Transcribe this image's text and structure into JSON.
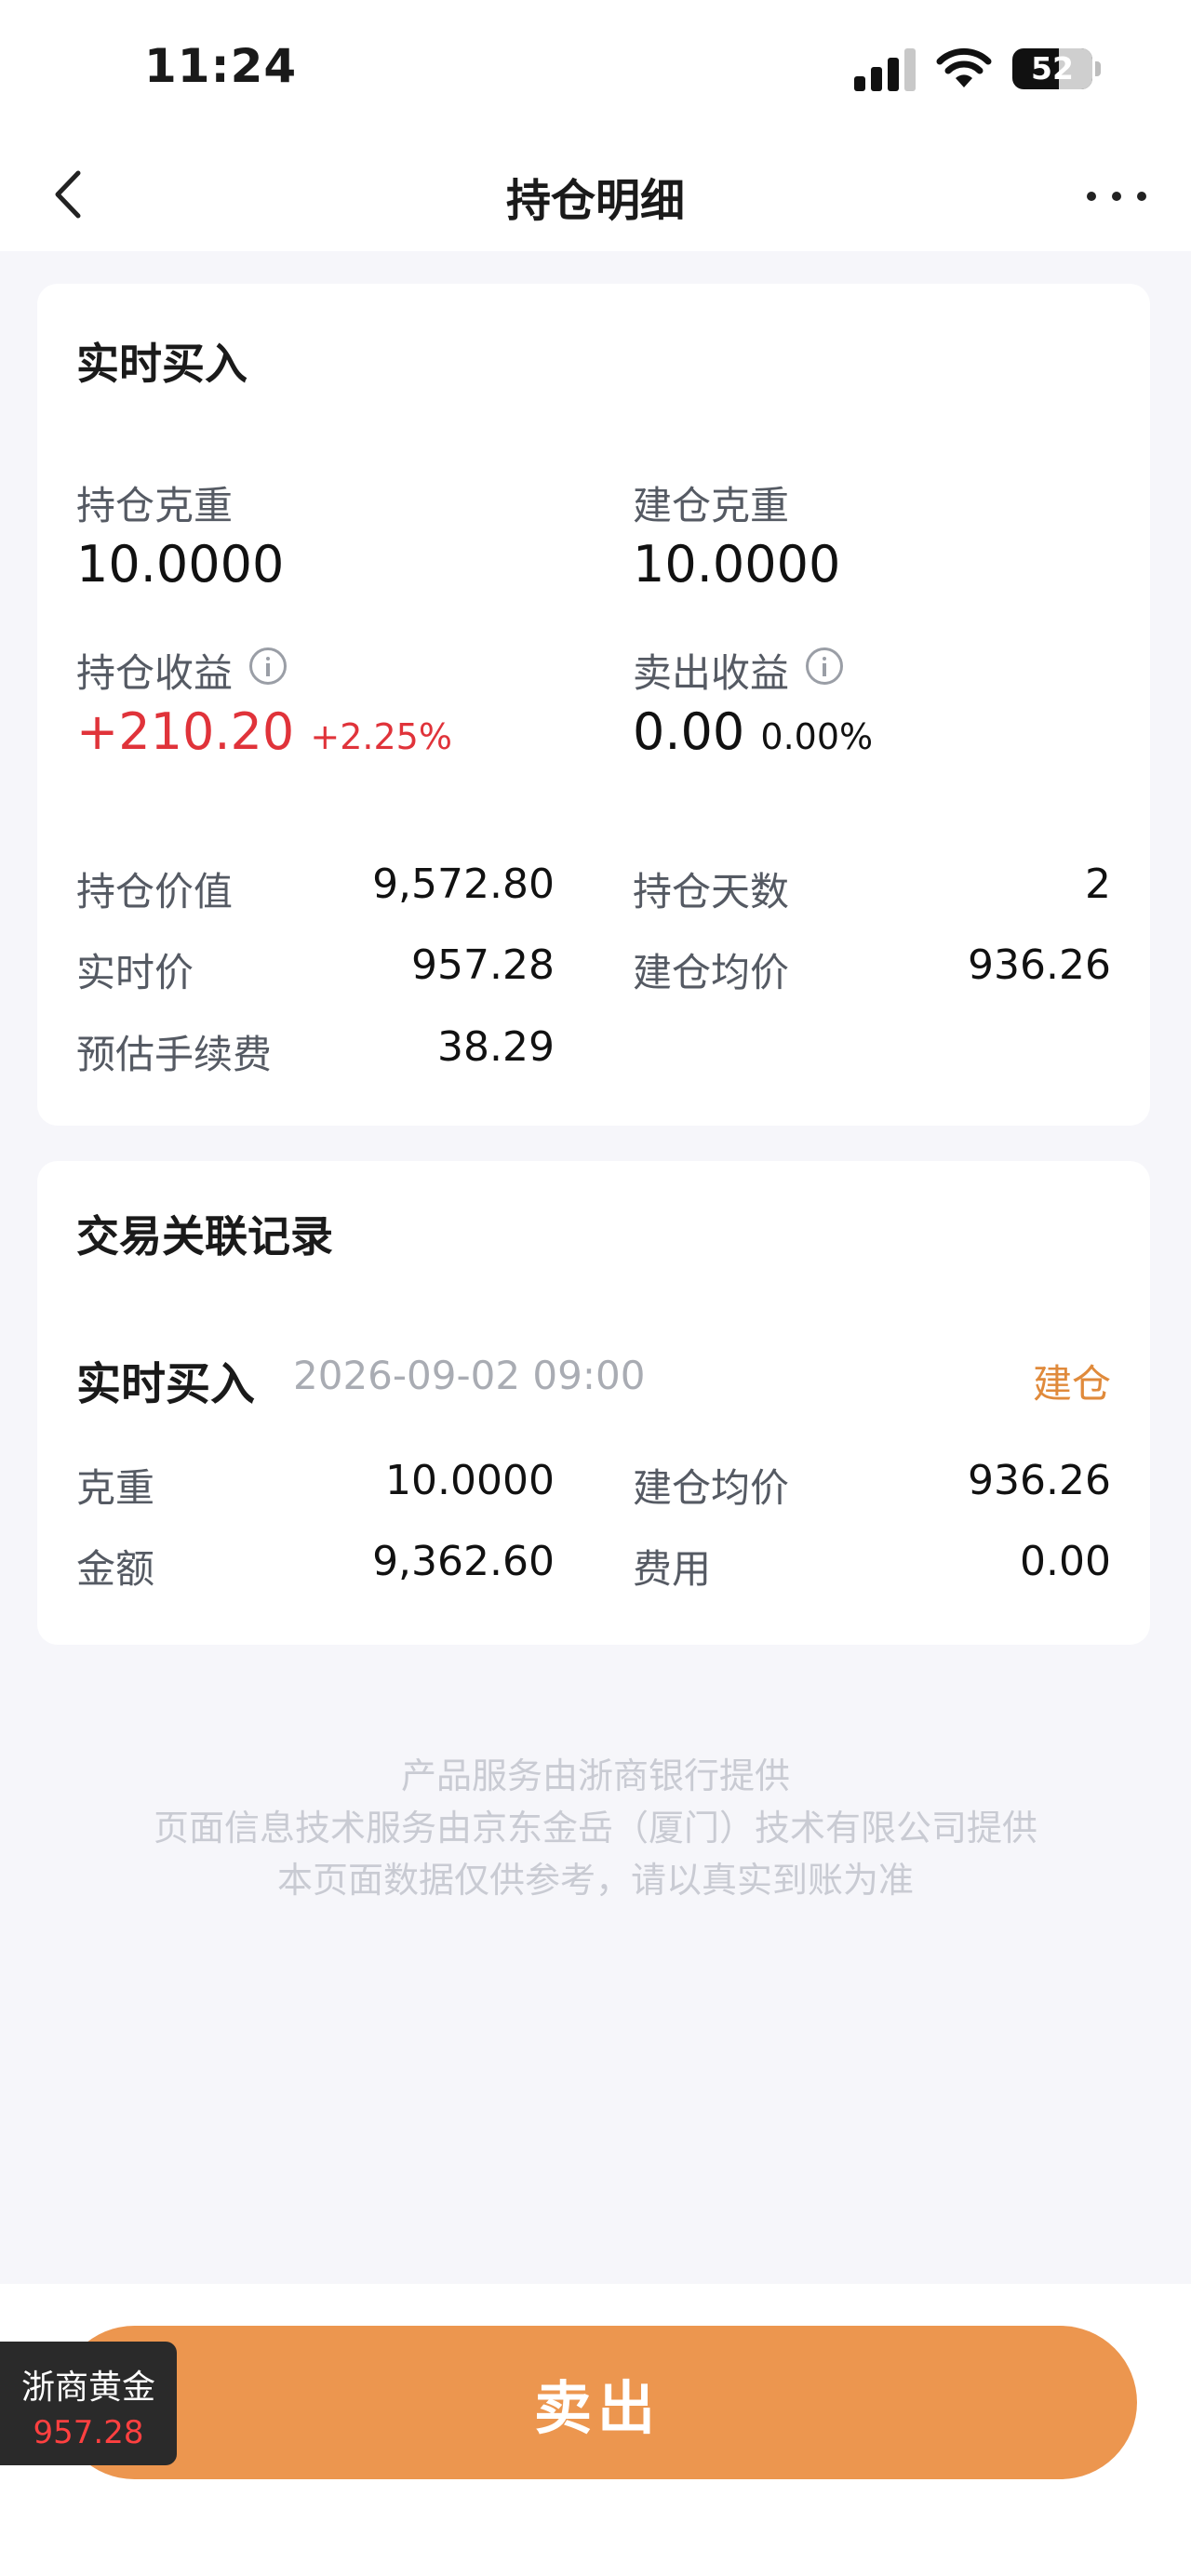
{
  "status_bar": {
    "time": "11:24",
    "battery": "52"
  },
  "nav": {
    "title": "持仓明细"
  },
  "position_card": {
    "title": "实时买入",
    "holding_weight_label": "持仓克重",
    "holding_weight_value": "10.0000",
    "opening_weight_label": "建仓克重",
    "opening_weight_value": "10.0000",
    "holding_profit_label": "持仓收益",
    "holding_profit_value": "+210.20",
    "holding_profit_pct": "+2.25%",
    "sell_profit_label": "卖出收益",
    "sell_profit_value": "0.00",
    "sell_profit_pct": "0.00%",
    "details": [
      {
        "label": "持仓价值",
        "value": "9,572.80"
      },
      {
        "label": "持仓天数",
        "value": "2"
      },
      {
        "label": "实时价",
        "value": "957.28"
      },
      {
        "label": "建仓均价",
        "value": "936.26"
      },
      {
        "label": "预估手续费",
        "value": "38.29"
      }
    ]
  },
  "records_card": {
    "title": "交易关联记录",
    "record": {
      "type": "实时买入",
      "datetime": "2026-09-02 09:00",
      "tag": "建仓",
      "fields": [
        {
          "label": "克重",
          "value": "10.0000"
        },
        {
          "label": "建仓均价",
          "value": "936.26"
        },
        {
          "label": "金额",
          "value": "9,362.60"
        },
        {
          "label": "费用",
          "value": "0.00"
        }
      ]
    }
  },
  "footer": {
    "line1": "产品服务由浙商银行提供",
    "line2": "页面信息技术服务由京东金岳（厦门）技术有限公司提供",
    "line3": "本页面数据仅供参考，请以真实到账为准"
  },
  "sell_button": {
    "label": "卖出"
  },
  "price_widget": {
    "name": "浙商黄金",
    "price": "957.28"
  },
  "colors": {
    "profit_red": "#e0333a",
    "accent_orange": "#ec964f",
    "tag_orange": "#e08a3b"
  }
}
